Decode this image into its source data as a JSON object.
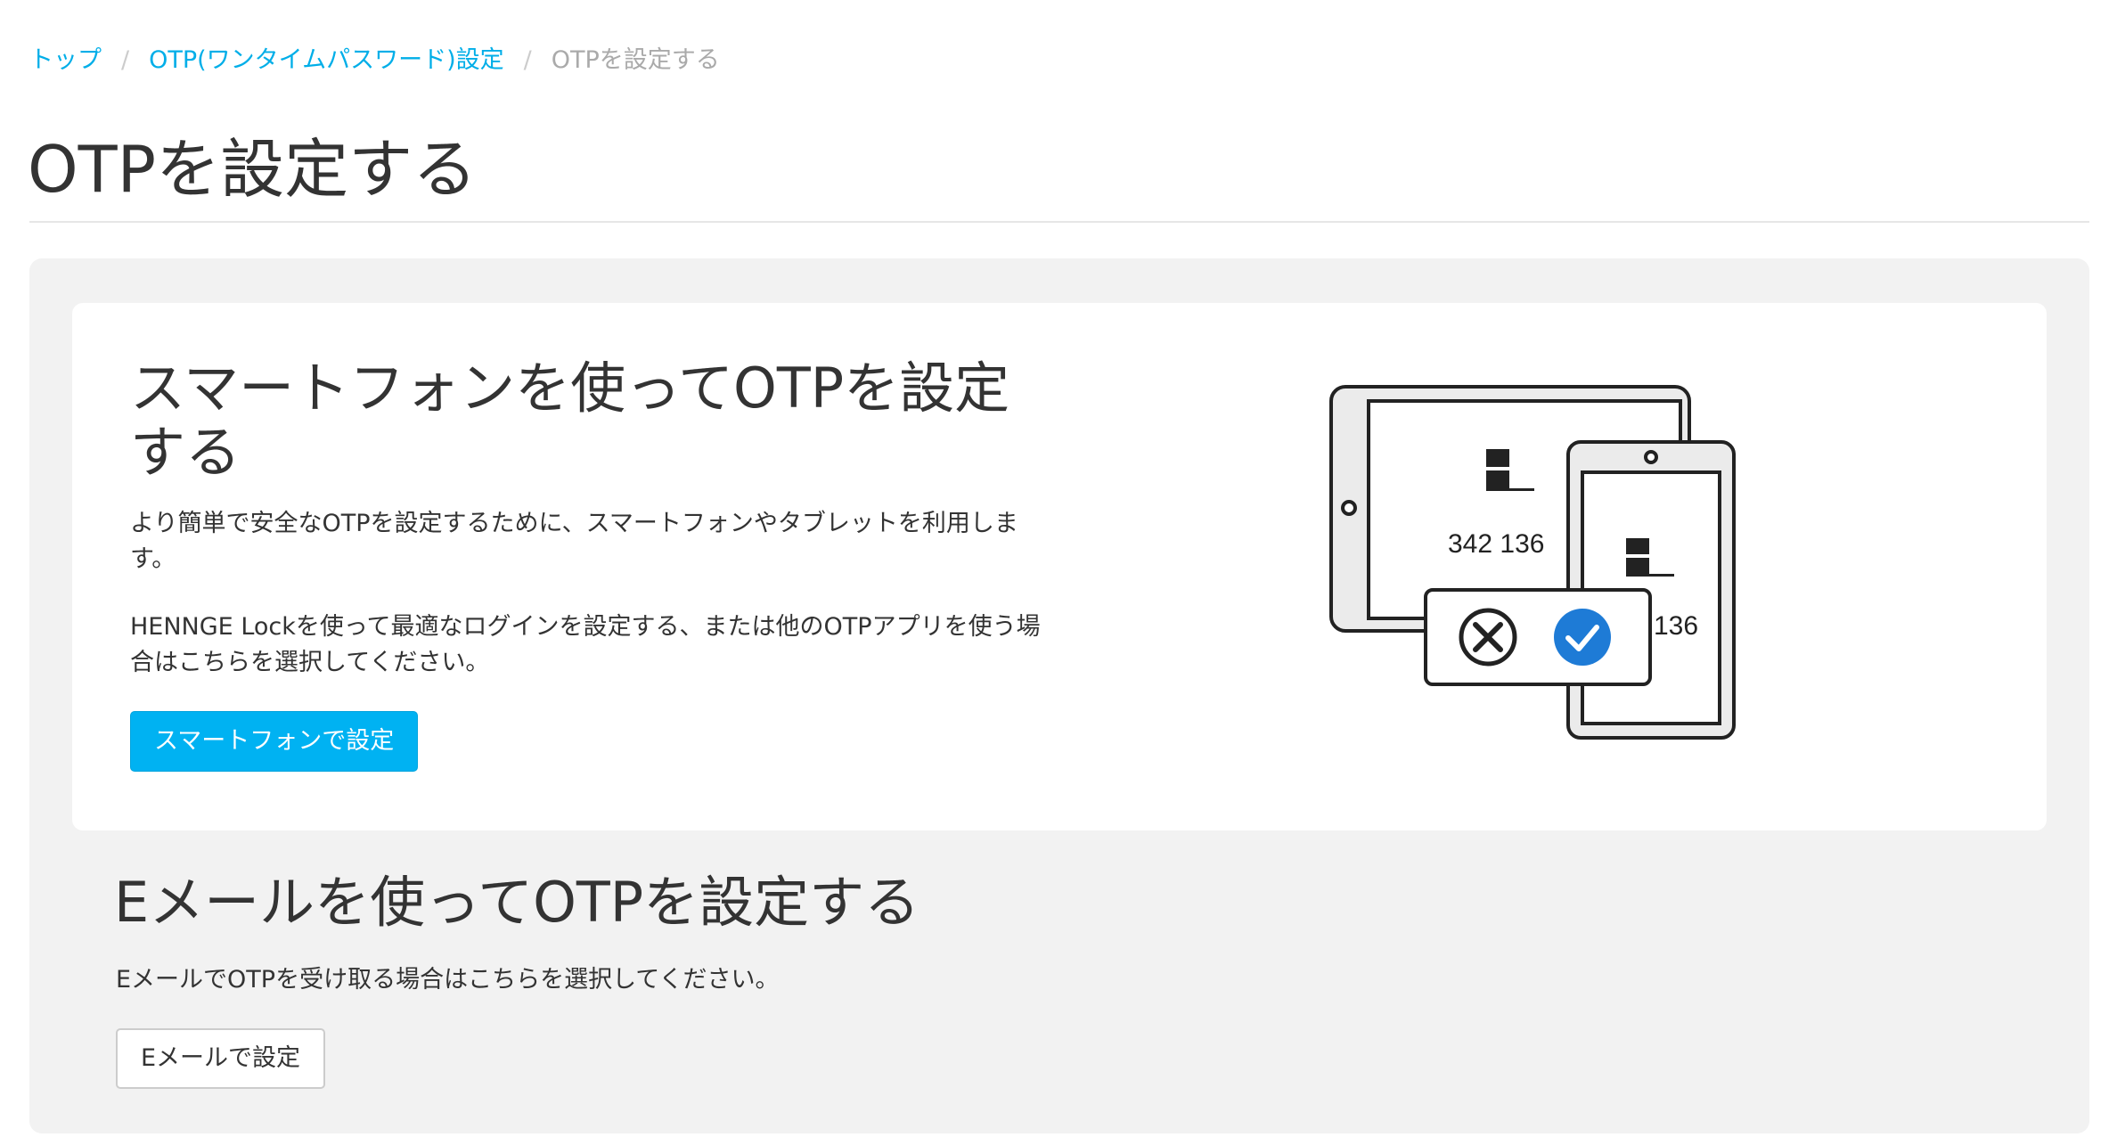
{
  "breadcrumb": {
    "items": [
      {
        "label": "トップ"
      },
      {
        "label": "OTP(ワンタイムパスワード)設定"
      }
    ],
    "separator": "/",
    "current": "OTPを設定する"
  },
  "page": {
    "title": "OTPを設定する"
  },
  "smartphone": {
    "title": "スマートフォンを使ってOTPを設定する",
    "desc1": "より簡単で安全なOTPを設定するために、スマートフォンやタブレットを利用します。",
    "desc2": "HENNGE Lockを使って最適なログインを設定する、または他のOTPアプリを使う場合はこちらを選択してください。",
    "button_label": "スマートフォンで設定",
    "illustration": {
      "tablet_code": "342 136",
      "phone_code": "136",
      "icons": [
        "logo-icon",
        "reject-icon",
        "approve-icon"
      ]
    }
  },
  "email": {
    "title": "Eメールを使ってOTPを設定する",
    "desc": "EメールでOTPを受け取る場合はこちらを選択してください。",
    "button_label": "Eメールで設定"
  },
  "colors": {
    "link": "#00aee8",
    "primary_button": "#00b2f2",
    "panel_bg": "#f2f2f2",
    "approve": "#1e7bd6"
  }
}
